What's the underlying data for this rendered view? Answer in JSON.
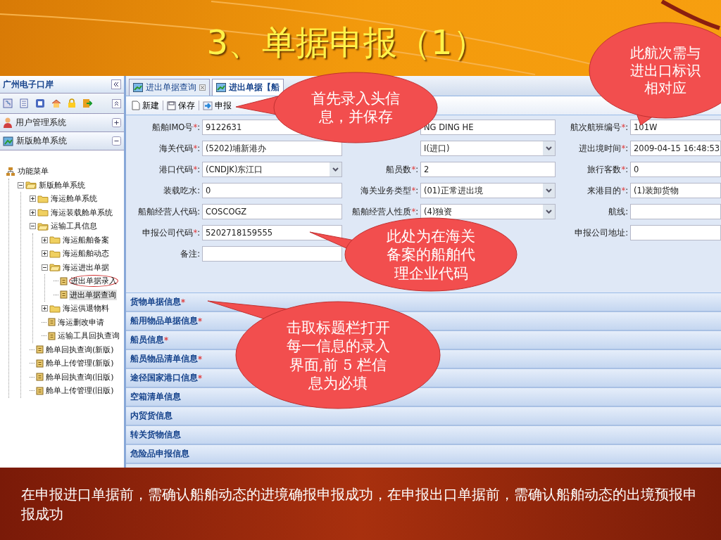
{
  "slide": {
    "title": "3、单据申报（1）",
    "note": "在申报进口单据前，需确认船舶动态的进境确报申报成功，在申报出口单据前，需确认船舶动态的出境预报申报成功"
  },
  "app": {
    "title": "广州电子口岸",
    "accordion": [
      {
        "label": "用户管理系统",
        "expanded": false
      },
      {
        "label": "新版舱单系统",
        "expanded": true
      }
    ],
    "tree": {
      "label": "功能菜单",
      "children": [
        {
          "label": "新版舱单系统",
          "expanded": true,
          "selected": false,
          "children": [
            {
              "label": "海运舱单系统",
              "expanded": false,
              "selected": false
            },
            {
              "label": "海运装载舱单系统",
              "expanded": false,
              "selected": false
            },
            {
              "label": "运输工具信息",
              "expanded": true,
              "selected": false,
              "children": [
                {
                  "label": "海运船舶备案",
                  "expanded": false,
                  "selected": false
                },
                {
                  "label": "海运船舶动态",
                  "expanded": false,
                  "selected": false
                },
                {
                  "label": "海运进出单据",
                  "expanded": true,
                  "selected": false,
                  "children": [
                    {
                      "label": "进出单据录入",
                      "selected": false,
                      "circled": true
                    },
                    {
                      "label": "进出单据查询",
                      "selected": true,
                      "circled": false
                    }
                  ]
                },
                {
                  "label": "海运供退物料",
                  "expanded": false,
                  "selected": false
                },
                {
                  "label": "海运删改申请",
                  "selected": false,
                  "circled": false
                },
                {
                  "label": "运输工具回执查询",
                  "selected": false,
                  "circled": false
                }
              ]
            },
            {
              "label": "舱单回执查询(新版)",
              "selected": false,
              "circled": false
            },
            {
              "label": "舱单上传管理(新版)",
              "selected": false,
              "circled": false
            },
            {
              "label": "舱单回执查询(旧版)",
              "selected": false,
              "circled": false
            },
            {
              "label": "舱单上传管理(旧版)",
              "selected": false,
              "circled": false
            }
          ]
        }
      ]
    }
  },
  "tabs": [
    {
      "label": "进出单据查询",
      "selected": false
    },
    {
      "label": "进出单据【船",
      "selected": true
    }
  ],
  "toolbar": [
    {
      "label": "新建",
      "kind": "new"
    },
    {
      "label": "保存",
      "kind": "save"
    },
    {
      "label": "申报",
      "kind": "submit"
    }
  ],
  "form": {
    "rows": [
      [
        {
          "label": "船舶IMO号",
          "mark": "*",
          "colon": ":",
          "kind": "text",
          "value": "9122631"
        },
        {
          "kind": "text",
          "value": "NG DING HE"
        },
        {
          "label": "航次航班编号",
          "mark": "*",
          "colon": ":",
          "kind": "text",
          "value": "101W"
        }
      ],
      [
        {
          "label": "海关代码",
          "mark": "*",
          "colon": ":",
          "kind": "text",
          "value": "(5202)埔新港办"
        },
        {
          "kind": "combo",
          "value": "I(进口)"
        },
        {
          "label": "进出境时间",
          "mark": "*",
          "colon": ":",
          "kind": "text",
          "value": "2009-04-15 16:48:53"
        }
      ],
      [
        {
          "label": "港口代码",
          "mark": "*",
          "colon": ":",
          "kind": "combo",
          "value": "(CNDJK)东江口"
        },
        {
          "label": "船员数",
          "mark": "*",
          "colon": ":",
          "kind": "text",
          "value": "2"
        },
        {
          "label": "旅行客数",
          "mark": "*",
          "colon": ":",
          "kind": "text",
          "value": "0"
        }
      ],
      [
        {
          "label": "装载吃水",
          "colon": ":",
          "kind": "text",
          "value": "0"
        },
        {
          "label": "海关业务类型",
          "mark": "*",
          "colon": ":",
          "kind": "combo",
          "value": "(01)正常进出境"
        },
        {
          "label": "来港目的",
          "mark": "*",
          "colon": ":",
          "kind": "text",
          "value": "(1)装卸货物"
        }
      ],
      [
        {
          "label": "船舶经营人代码",
          "colon": ":",
          "kind": "text",
          "value": "COSCOGZ"
        },
        {
          "label": "船舶经营人性质",
          "mark": "*",
          "colon": ":",
          "kind": "combo",
          "value": "(4)独资"
        },
        {
          "label": "航线",
          "colon": ":",
          "kind": "text"
        }
      ],
      [
        {
          "label": "申报公司代码",
          "mark": "*",
          "colon": ":",
          "kind": "text",
          "value": "5202718159555"
        },
        {
          "kind": "hidden"
        },
        {
          "label": "申报公司地址",
          "colon": ":",
          "kind": "text"
        }
      ],
      [
        {
          "label": "备注",
          "colon": ":",
          "kind": "text"
        }
      ]
    ]
  },
  "sections": [
    {
      "label": "货物单据信息",
      "mark": "*"
    },
    {
      "label": "船用物品单据信息",
      "mark": "*"
    },
    {
      "label": "船员信息",
      "mark": "*"
    },
    {
      "label": "船员物品清单信息",
      "mark": "*"
    },
    {
      "label": "途径国家港口信息",
      "mark": "*"
    },
    {
      "label": "空箱清单信息"
    },
    {
      "label": "内贸货信息"
    },
    {
      "label": "转关货物信息"
    },
    {
      "label": "危险品申报信息"
    }
  ],
  "callouts": [
    {
      "text": "首先录入头信息，并保存"
    },
    {
      "text": "此处为在海关备案的船舶代理企业代码"
    },
    {
      "text": "击取标题栏打开每一信息的录入界面,前 5 栏信息为必填"
    },
    {
      "text": "此航次需与进出口标识相对应"
    }
  ]
}
